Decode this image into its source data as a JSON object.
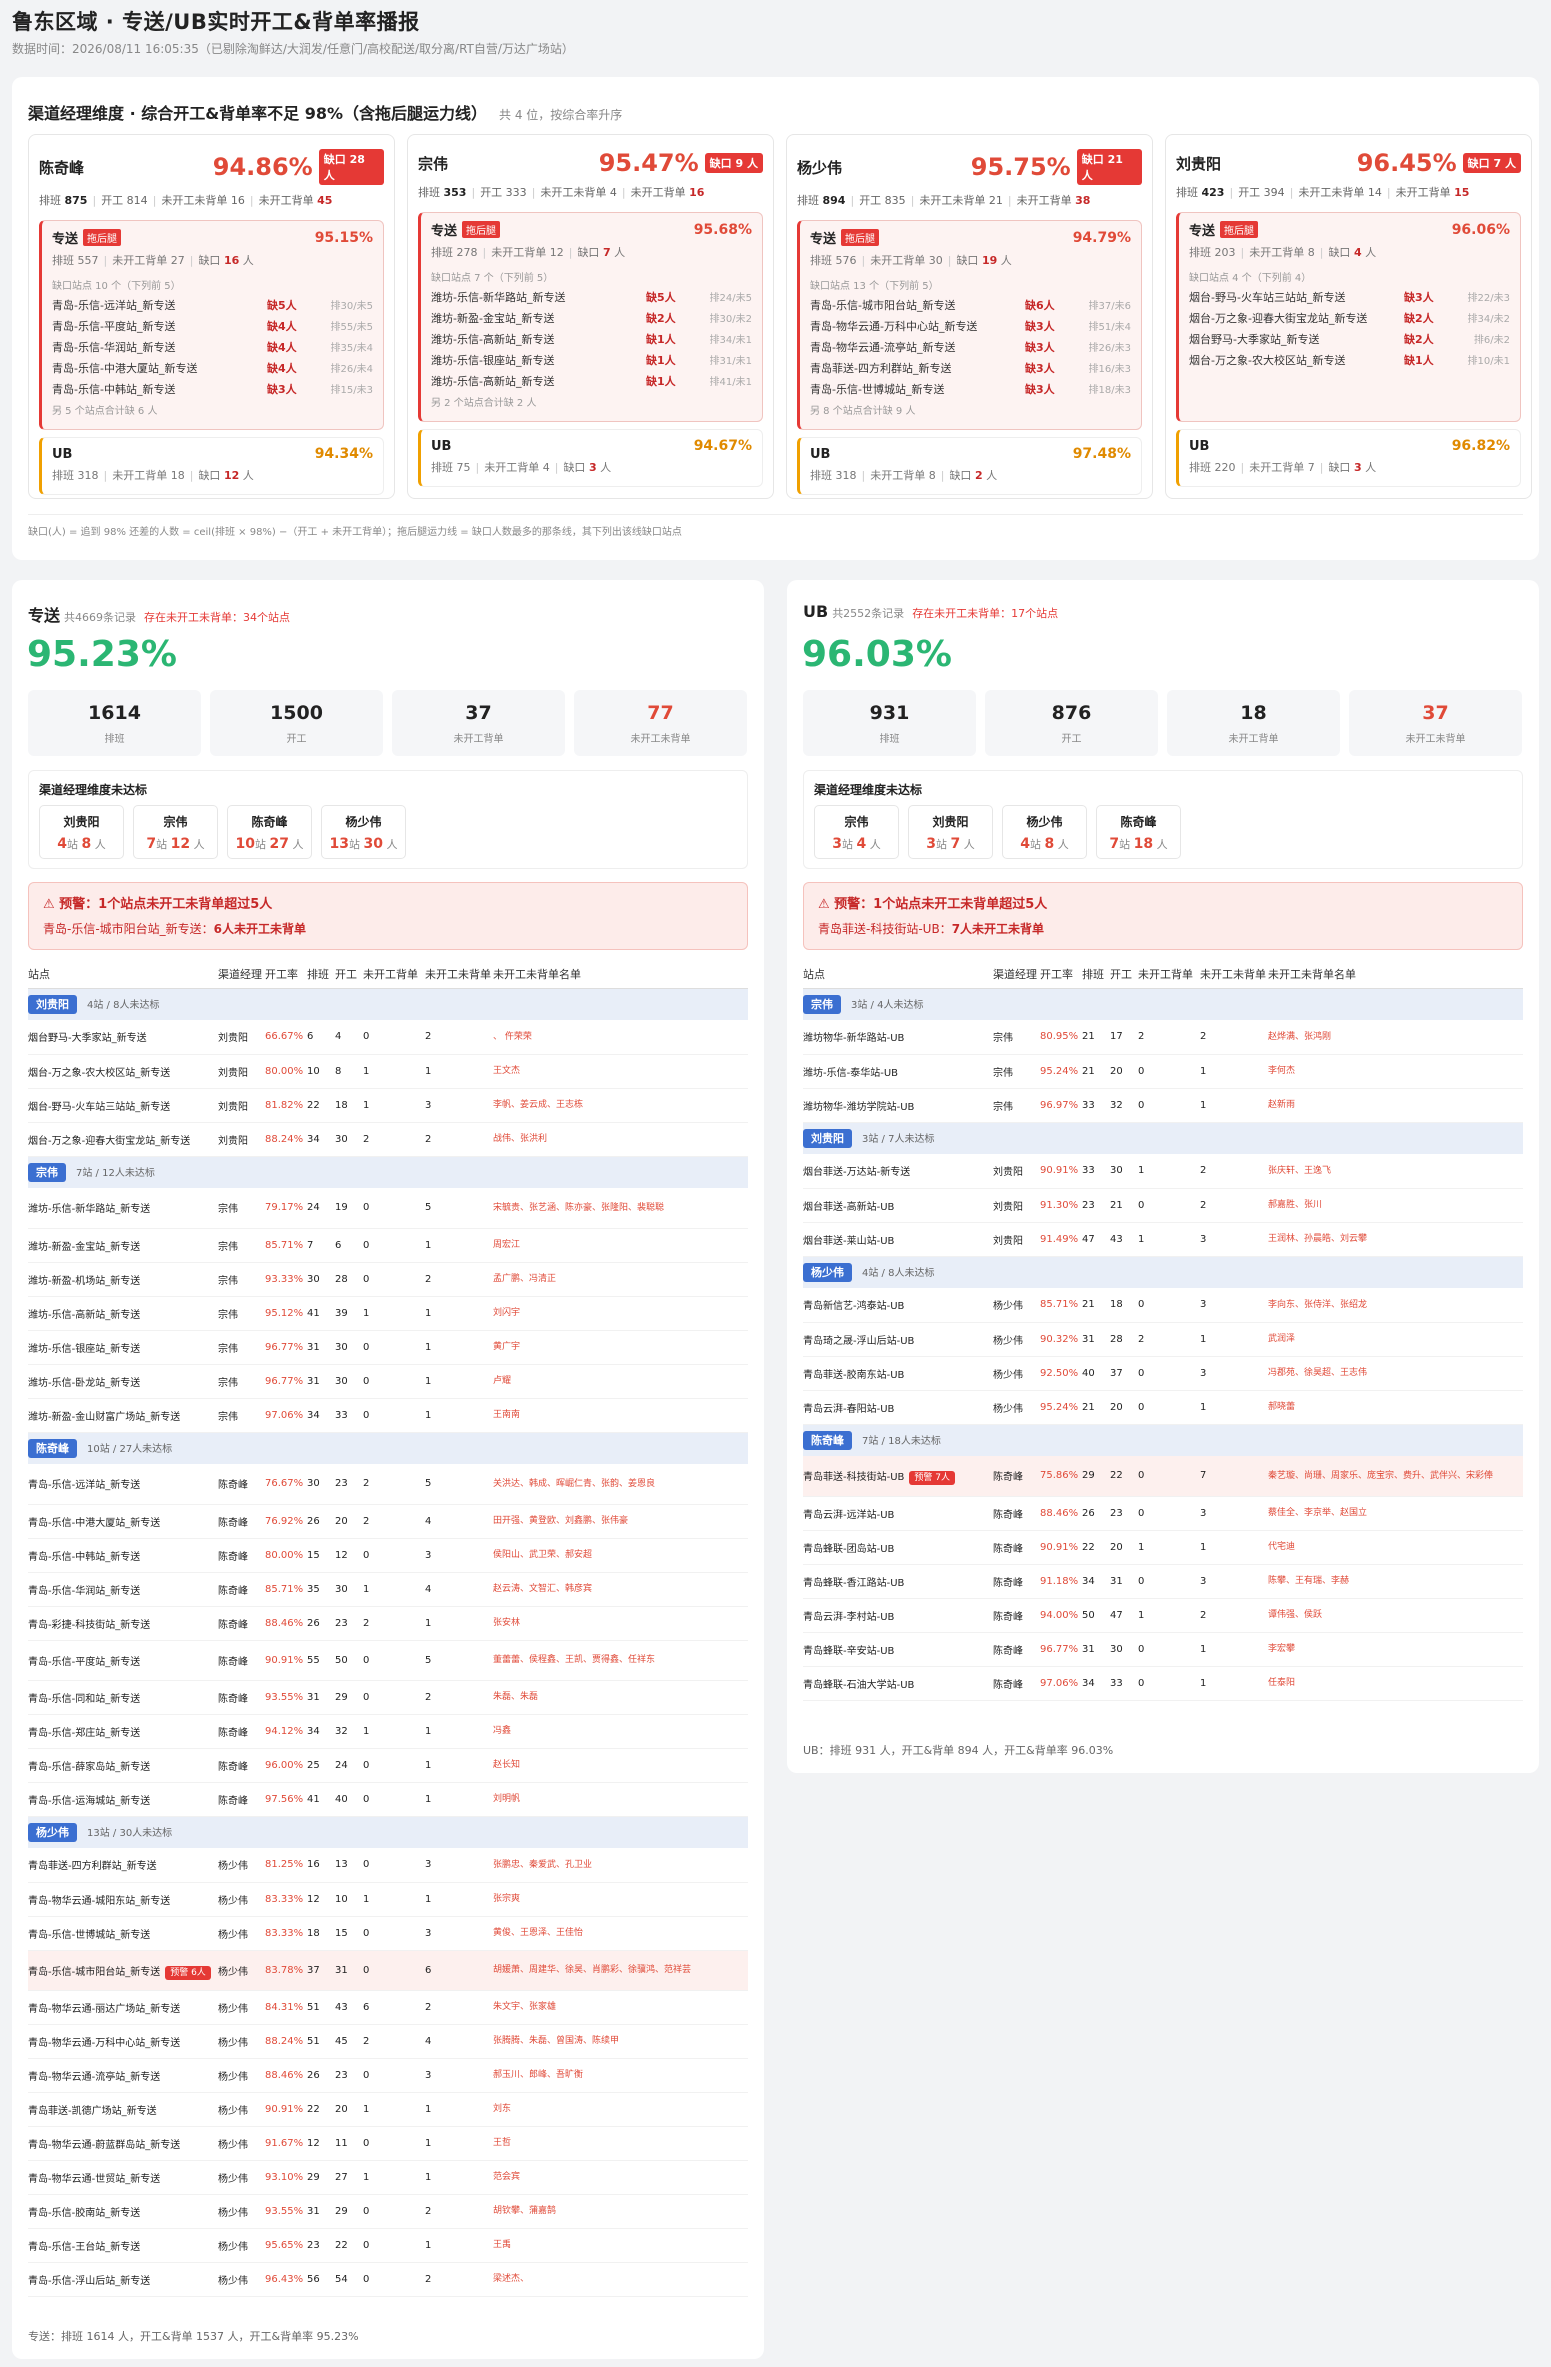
{
  "header": {
    "title": "鲁东区域 · 专送/UB实时开工&背单率播报",
    "sub": "数据时间：2026/08/11 16:05:35（已剔除淘鲜达/大润发/任意门/高校配送/取分离/RT自营/万达广场站）"
  },
  "mgr_section": {
    "title": "渠道经理维度 · 综合开工&背单率不足 98%（含拖后腿运力线）",
    "count": "共 4 位，按综合率升序",
    "footnote": "缺口(人) = 追到 98% 还差的人数 = ceil(排班 × 98%) −（开工 + 未开工背单）；拖后腿运力线 = 缺口人数最多的那条线，其下列出该线缺口站点",
    "labels": {
      "sched": "排班",
      "work": "开工",
      "nw_ns": "未开工未背单",
      "gap": "缺口",
      "near_nw": "未开工背单",
      "tag": "拖后腿"
    },
    "managers": [
      {
        "name": "陈奇峰",
        "rate": "94.86%",
        "gap_badge": "缺口 28 人",
        "sched": "875",
        "work": "814",
        "nw_ns": "16",
        "nw_s": "45",
        "ch": {
          "name": "专送",
          "rate": "95.15%",
          "sched": "557",
          "nw_s": "27",
          "gap": "16",
          "note": "缺口站点 10 个（下列前 5）",
          "stations": [
            [
              "青岛-乐信-远洋站_新专送",
              "缺5人",
              "排30/未5"
            ],
            [
              "青岛-乐信-平度站_新专送",
              "缺4人",
              "排55/未5"
            ],
            [
              "青岛-乐信-华润站_新专送",
              "缺4人",
              "排35/未4"
            ],
            [
              "青岛-乐信-中港大厦站_新专送",
              "缺4人",
              "排26/未4"
            ],
            [
              "青岛-乐信-中韩站_新专送",
              "缺3人",
              "排15/未3"
            ]
          ],
          "more": "另 5 个站点合计缺 6 人"
        },
        "ub": {
          "name": "UB",
          "rate": "94.34%",
          "sched": "318",
          "nw_s": "18",
          "gap": "12"
        }
      },
      {
        "name": "宗伟",
        "rate": "95.47%",
        "gap_badge": "缺口 9 人",
        "sched": "353",
        "work": "333",
        "nw_ns": "4",
        "nw_s": "16",
        "ch": {
          "name": "专送",
          "rate": "95.68%",
          "sched": "278",
          "nw_s": "12",
          "gap": "7",
          "note": "缺口站点 7 个（下列前 5）",
          "stations": [
            [
              "潍坊-乐信-新华路站_新专送",
              "缺5人",
              "排24/未5"
            ],
            [
              "潍坊-新盈-金宝站_新专送",
              "缺2人",
              "排30/未2"
            ],
            [
              "潍坊-乐信-高新站_新专送",
              "缺1人",
              "排34/未1"
            ],
            [
              "潍坊-乐信-银座站_新专送",
              "缺1人",
              "排31/未1"
            ],
            [
              "潍坊-乐信-高新站_新专送",
              "缺1人",
              "排41/未1"
            ]
          ],
          "more": "另 2 个站点合计缺 2 人"
        },
        "ub": {
          "name": "UB",
          "rate": "94.67%",
          "sched": "75",
          "nw_s": "4",
          "gap": "3"
        }
      },
      {
        "name": "杨少伟",
        "rate": "95.75%",
        "gap_badge": "缺口 21 人",
        "sched": "894",
        "work": "835",
        "nw_ns": "21",
        "nw_s": "38",
        "ch": {
          "name": "专送",
          "rate": "94.79%",
          "sched": "576",
          "nw_s": "30",
          "gap": "19",
          "note": "缺口站点 13 个（下列前 5）",
          "stations": [
            [
              "青岛-乐信-城市阳台站_新专送",
              "缺6人",
              "排37/未6"
            ],
            [
              "青岛-物华云通-万科中心站_新专送",
              "缺3人",
              "排51/未4"
            ],
            [
              "青岛-物华云通-流亭站_新专送",
              "缺3人",
              "排26/未3"
            ],
            [
              "青岛菲送-四方利群站_新专送",
              "缺3人",
              "排16/未3"
            ],
            [
              "青岛-乐信-世博城站_新专送",
              "缺3人",
              "排18/未3"
            ]
          ],
          "more": "另 8 个站点合计缺 9 人"
        },
        "ub": {
          "name": "UB",
          "rate": "97.48%",
          "sched": "318",
          "nw_s": "8",
          "gap": "2"
        }
      },
      {
        "name": "刘贵阳",
        "rate": "96.45%",
        "gap_badge": "缺口 7 人",
        "sched": "423",
        "work": "394",
        "nw_ns": "14",
        "nw_s": "15",
        "ch": {
          "name": "专送",
          "rate": "96.06%",
          "sched": "203",
          "nw_s": "8",
          "gap": "4",
          "note": "缺口站点 4 个（下列前 4）",
          "stations": [
            [
              "烟台-野马-火车站三站站_新专送",
              "缺3人",
              "排22/未3"
            ],
            [
              "烟台-万之象-迎春大街宝龙站_新专送",
              "缺2人",
              "排34/未2"
            ],
            [
              "烟台野马-大季家站_新专送",
              "缺2人",
              "排6/未2"
            ],
            [
              "烟台-万之象-农大校区站_新专送",
              "缺1人",
              "排10/未1"
            ]
          ],
          "more": ""
        },
        "ub": {
          "name": "UB",
          "rate": "96.82%",
          "sched": "220",
          "nw_s": "7",
          "gap": "3"
        }
      }
    ]
  },
  "express": {
    "title": "专送",
    "count": "共4669条记录",
    "warn": "存在未开工未背单：34个站点",
    "rate": "95.23%",
    "kpis": [
      {
        "v": "1614",
        "l": "排班"
      },
      {
        "v": "1500",
        "l": "开工"
      },
      {
        "v": "37",
        "l": "未开工背单"
      },
      {
        "v": "77",
        "l": "未开工未背单"
      }
    ],
    "ach_title": "渠道经理维度未达标",
    "chips": [
      {
        "n": "刘贵阳",
        "s": "4",
        "p": "8"
      },
      {
        "n": "宗伟",
        "s": "7",
        "p": "12"
      },
      {
        "n": "陈奇峰",
        "s": "10",
        "p": "27"
      },
      {
        "n": "杨少伟",
        "s": "13",
        "p": "30"
      }
    ],
    "alert_t": "⚠ 预警：1个站点未开工未背单超过5人",
    "alert_st": "青岛-乐信-城市阳台站_新专送：",
    "alert_n": "6人未开工未背单",
    "footer": "专送：排班 1614 人，开工&背单 1537 人，开工&背单率 95.23%"
  },
  "ubsec": {
    "title": "UB",
    "count": "共2552条记录",
    "warn": "存在未开工未背单：17个站点",
    "rate": "96.03%",
    "kpis": [
      {
        "v": "931",
        "l": "排班"
      },
      {
        "v": "876",
        "l": "开工"
      },
      {
        "v": "18",
        "l": "未开工背单"
      },
      {
        "v": "37",
        "l": "未开工未背单"
      }
    ],
    "ach_title": "渠道经理维度未达标",
    "chips": [
      {
        "n": "宗伟",
        "s": "3",
        "p": "4"
      },
      {
        "n": "刘贵阳",
        "s": "3",
        "p": "7"
      },
      {
        "n": "杨少伟",
        "s": "4",
        "p": "8"
      },
      {
        "n": "陈奇峰",
        "s": "7",
        "p": "18"
      }
    ],
    "alert_t": "⚠ 预警：1个站点未开工未背单超过5人",
    "alert_st": "青岛菲送-科技街站-UB：",
    "alert_n": "7人未开工未背单",
    "footer": "UB：排班 931 人，开工&背单 894 人，开工&背单率 96.03%"
  },
  "table_headers": [
    "站点",
    "渠道经理",
    "开工率",
    "排班",
    "开工",
    "未开工背单",
    "未开工未背单",
    "未开工未背单名单"
  ],
  "labels": {
    "sites": "站",
    "people": "人",
    "warn_prefix": "预警 "
  },
  "express_groups": [
    {
      "mgr": "刘贵阳",
      "desc": "4站 / 8人未达标",
      "rows": [
        [
          "烟台野马-大季家站_新专送",
          "刘贵阳",
          "66.67%",
          "6",
          "4",
          "0",
          "2",
          "、 仵荣荣"
        ],
        [
          "烟台-万之象-农大校区站_新专送",
          "刘贵阳",
          "80.00%",
          "10",
          "8",
          "1",
          "1",
          "王文杰"
        ],
        [
          "烟台-野马-火车站三站站_新专送",
          "刘贵阳",
          "81.82%",
          "22",
          "18",
          "1",
          "3",
          "李帆、姜云成、王志栋"
        ],
        [
          "烟台-万之象-迎春大街宝龙站_新专送",
          "刘贵阳",
          "88.24%",
          "34",
          "30",
          "2",
          "2",
          "战伟、张洪利"
        ]
      ]
    },
    {
      "mgr": "宗伟",
      "desc": "7站 / 12人未达标",
      "rows": [
        [
          "潍坊-乐信-新华路站_新专送",
          "宗伟",
          "79.17%",
          "24",
          "19",
          "0",
          "5",
          "宋毓贵、张艺涵、陈亦豪、张隆阳、裴聪聪"
        ],
        [
          "潍坊-新盈-金宝站_新专送",
          "宗伟",
          "85.71%",
          "7",
          "6",
          "0",
          "1",
          "周宏江"
        ],
        [
          "潍坊-新盈-机场站_新专送",
          "宗伟",
          "93.33%",
          "30",
          "28",
          "0",
          "2",
          "孟广鹏、冯清正"
        ],
        [
          "潍坊-乐信-高新站_新专送",
          "宗伟",
          "95.12%",
          "41",
          "39",
          "1",
          "1",
          "刘闪宇"
        ],
        [
          "潍坊-乐信-银座站_新专送",
          "宗伟",
          "96.77%",
          "31",
          "30",
          "0",
          "1",
          "黄广宇"
        ],
        [
          "潍坊-乐信-卧龙站_新专送",
          "宗伟",
          "96.77%",
          "31",
          "30",
          "0",
          "1",
          "卢耀"
        ],
        [
          "潍坊-新盈-金山财富广场站_新专送",
          "宗伟",
          "97.06%",
          "34",
          "33",
          "0",
          "1",
          "王南南"
        ]
      ]
    },
    {
      "mgr": "陈奇峰",
      "desc": "10站 / 27人未达标",
      "rows": [
        [
          "青岛-乐信-远洋站_新专送",
          "陈奇峰",
          "76.67%",
          "30",
          "23",
          "2",
          "5",
          "关洪达、韩成、晖崛仁青、张韵、姜恩良"
        ],
        [
          "青岛-乐信-中港大厦站_新专送",
          "陈奇峰",
          "76.92%",
          "26",
          "20",
          "2",
          "4",
          "田开强、黄登欧、刘鑫鹏、张伟豪"
        ],
        [
          "青岛-乐信-中韩站_新专送",
          "陈奇峰",
          "80.00%",
          "15",
          "12",
          "0",
          "3",
          "侯阳山、武卫荣、郝安超"
        ],
        [
          "青岛-乐信-华润站_新专送",
          "陈奇峰",
          "85.71%",
          "35",
          "30",
          "1",
          "4",
          "赵云涛、文智汇、韩彦宾"
        ],
        [
          "青岛-彩捷-科技街站_新专送",
          "陈奇峰",
          "88.46%",
          "26",
          "23",
          "2",
          "1",
          "张安林"
        ],
        [
          "青岛-乐信-平度站_新专送",
          "陈奇峰",
          "90.91%",
          "55",
          "50",
          "0",
          "5",
          "董蕾蕾、侯程鑫、王凯、贾得鑫、任祥东"
        ],
        [
          "青岛-乐信-同和站_新专送",
          "陈奇峰",
          "93.55%",
          "31",
          "29",
          "0",
          "2",
          "朱磊、朱磊"
        ],
        [
          "青岛-乐信-郑庄站_新专送",
          "陈奇峰",
          "94.12%",
          "34",
          "32",
          "1",
          "1",
          "冯鑫"
        ],
        [
          "青岛-乐信-薛家岛站_新专送",
          "陈奇峰",
          "96.00%",
          "25",
          "24",
          "0",
          "1",
          "赵长知"
        ],
        [
          "青岛-乐信-运海城站_新专送",
          "陈奇峰",
          "97.56%",
          "41",
          "40",
          "0",
          "1",
          "刘明帆"
        ]
      ]
    },
    {
      "mgr": "杨少伟",
      "desc": "13站 / 30人未达标",
      "rows": [
        [
          "青岛菲送-四方利群站_新专送",
          "杨少伟",
          "81.25%",
          "16",
          "13",
          "0",
          "3",
          "张鹏忠、秦爱武、孔卫业"
        ],
        [
          "青岛-物华云通-城阳东站_新专送",
          "杨少伟",
          "83.33%",
          "12",
          "10",
          "1",
          "1",
          "张宗爽"
        ],
        [
          "青岛-乐信-世博城站_新专送",
          "杨少伟",
          "83.33%",
          "18",
          "15",
          "0",
          "3",
          "黄俊、王恩泽、王佳怡"
        ],
        [
          "青岛-乐信-城市阳台站_新专送",
          "杨少伟",
          "83.78%",
          "37",
          "31",
          "0",
          "6",
          "胡媛萧、周建华、徐昊、肖鹏彩、徐骥鸿、范祥芸",
          "warn"
        ],
        [
          "青岛-物华云通-丽达广场站_新专送",
          "杨少伟",
          "84.31%",
          "51",
          "43",
          "6",
          "2",
          "朱文宇、张家雄"
        ],
        [
          "青岛-物华云通-万科中心站_新专送",
          "杨少伟",
          "88.24%",
          "51",
          "45",
          "2",
          "4",
          "张腾腾、朱磊、曾国涛、陈续甲"
        ],
        [
          "青岛-物华云通-流亭站_新专送",
          "杨少伟",
          "88.46%",
          "26",
          "23",
          "0",
          "3",
          "郝玉川、郎峰、吾旷衡"
        ],
        [
          "青岛菲送-凯德广场站_新专送",
          "杨少伟",
          "90.91%",
          "22",
          "20",
          "1",
          "1",
          "刘东"
        ],
        [
          "青岛-物华云通-蔚蓝群岛站_新专送",
          "杨少伟",
          "91.67%",
          "12",
          "11",
          "0",
          "1",
          "王哲"
        ],
        [
          "青岛-物华云通-世贸站_新专送",
          "杨少伟",
          "93.10%",
          "29",
          "27",
          "1",
          "1",
          "范会宾"
        ],
        [
          "青岛-乐信-胶南站_新专送",
          "杨少伟",
          "93.55%",
          "31",
          "29",
          "0",
          "2",
          "胡钦攀、蒲嘉鹄"
        ],
        [
          "青岛-乐信-王台站_新专送",
          "杨少伟",
          "95.65%",
          "23",
          "22",
          "0",
          "1",
          "王禹"
        ],
        [
          "青岛-乐信-浮山后站_新专送",
          "杨少伟",
          "96.43%",
          "56",
          "54",
          "0",
          "2",
          "梁述杰、"
        ]
      ]
    }
  ],
  "ub_groups": [
    {
      "mgr": "宗伟",
      "desc": "3站 / 4人未达标",
      "rows": [
        [
          "潍坊物华-新华路站-UB",
          "宗伟",
          "80.95%",
          "21",
          "17",
          "2",
          "2",
          "赵烨满、张鸿刚"
        ],
        [
          "潍坊-乐信-泰华站-UB",
          "宗伟",
          "95.24%",
          "21",
          "20",
          "0",
          "1",
          "李何杰"
        ],
        [
          "潍坊物华-潍坊学院站-UB",
          "宗伟",
          "96.97%",
          "33",
          "32",
          "0",
          "1",
          "赵新雨"
        ]
      ]
    },
    {
      "mgr": "刘贵阳",
      "desc": "3站 / 7人未达标",
      "rows": [
        [
          "烟台菲送-万达站-新专送",
          "刘贵阳",
          "90.91%",
          "33",
          "30",
          "1",
          "2",
          "张庆轩、王逸飞"
        ],
        [
          "烟台菲送-高新站-UB",
          "刘贵阳",
          "91.30%",
          "23",
          "21",
          "0",
          "2",
          "郝嘉胜、张川"
        ],
        [
          "烟台菲送-莱山站-UB",
          "刘贵阳",
          "91.49%",
          "47",
          "43",
          "1",
          "3",
          "王润林、孙晨皓、刘云攀"
        ]
      ]
    },
    {
      "mgr": "杨少伟",
      "desc": "4站 / 8人未达标",
      "rows": [
        [
          "青岛新信艺-鸿泰站-UB",
          "杨少伟",
          "85.71%",
          "21",
          "18",
          "0",
          "3",
          "李向东、张侍洋、张绍龙"
        ],
        [
          "青岛琦之晟-浮山后站-UB",
          "杨少伟",
          "90.32%",
          "31",
          "28",
          "2",
          "1",
          "武润泽"
        ],
        [
          "青岛菲送-胶南东站-UB",
          "杨少伟",
          "92.50%",
          "40",
          "37",
          "0",
          "3",
          "冯郡苑、徐昊超、王志伟"
        ],
        [
          "青岛云湃-春阳站-UB",
          "杨少伟",
          "95.24%",
          "21",
          "20",
          "0",
          "1",
          "郝晓蕾"
        ]
      ]
    },
    {
      "mgr": "陈奇峰",
      "desc": "7站 / 18人未达标",
      "rows": [
        [
          "青岛菲送-科技街站-UB",
          "陈奇峰",
          "75.86%",
          "29",
          "22",
          "0",
          "7",
          "秦艺璇、尚珊、周家乐、庞宝宗、费升、武伴兴、宋彩俸",
          "warn"
        ],
        [
          "青岛云湃-远洋站-UB",
          "陈奇峰",
          "88.46%",
          "26",
          "23",
          "0",
          "3",
          "蔡佳全、李京举、赵国立"
        ],
        [
          "青岛蜂联-团岛站-UB",
          "陈奇峰",
          "90.91%",
          "22",
          "20",
          "1",
          "1",
          "代宅迪"
        ],
        [
          "青岛蜂联-香江路站-UB",
          "陈奇峰",
          "91.18%",
          "34",
          "31",
          "0",
          "3",
          "陈攀、王有瑞、李赫"
        ],
        [
          "青岛云湃-李村站-UB",
          "陈奇峰",
          "94.00%",
          "50",
          "47",
          "1",
          "2",
          "谭伟强、侯跃"
        ],
        [
          "青岛蜂联-辛安站-UB",
          "陈奇峰",
          "96.77%",
          "31",
          "30",
          "0",
          "1",
          "李宏攀"
        ],
        [
          "青岛蜂联-石油大学站-UB",
          "陈奇峰",
          "97.06%",
          "34",
          "33",
          "0",
          "1",
          "任泰阳"
        ]
      ]
    }
  ]
}
